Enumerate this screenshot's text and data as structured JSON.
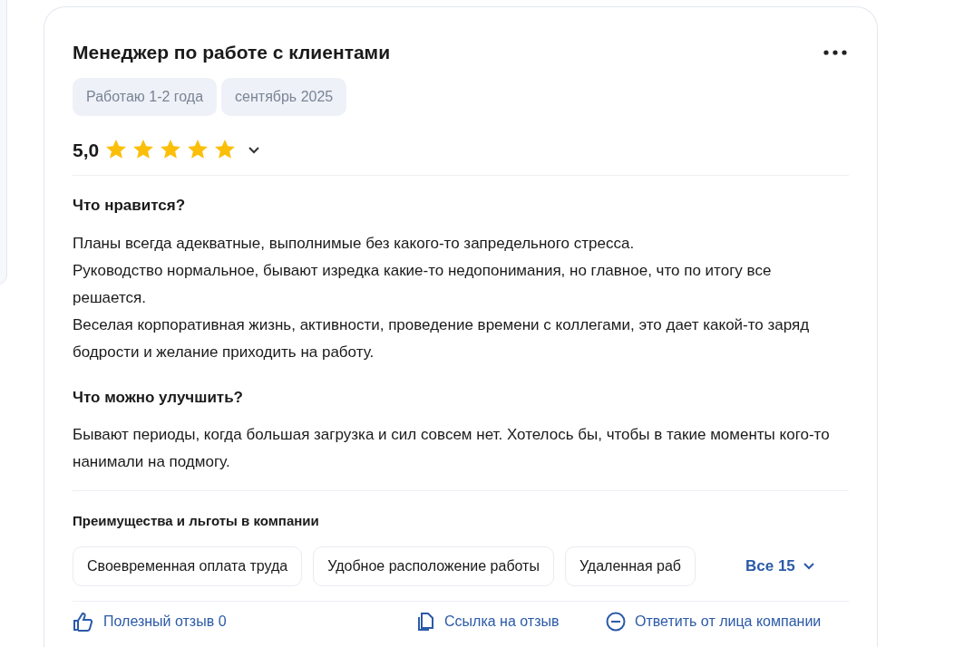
{
  "review": {
    "title": "Менеджер по работе с клиентами",
    "tags": [
      "Работаю 1-2 года",
      "сентябрь 2025"
    ],
    "rating": "5,0",
    "stars": 5,
    "sections": [
      {
        "heading": "Что нравится?",
        "paragraphs": [
          "Планы всегда адекватные, выполнимые без какого-то запредельного стресса.",
          "Руководство нормальное, бывают изредка какие-то недопонимания, но главное, что по итогу все решается.",
          "Веселая корпоративная жизнь, активности, проведение времени с коллегами, это дает какой-то заряд бодрости и желание приходить на работу."
        ]
      },
      {
        "heading": "Что можно улучшить?",
        "paragraphs": [
          "Бывают периоды, когда большая загрузка и сил совсем нет. Хотелось бы, чтобы в такие моменты кого-то нанимали на подмогу."
        ]
      }
    ],
    "benefits": {
      "heading": "Преимущества и льготы в компании",
      "items": [
        "Своевременная оплата труда",
        "Удобное расположение работы",
        "Удаленная раб"
      ],
      "more": "Все 15"
    },
    "actions": [
      {
        "kind": "like",
        "label": "Полезный отзыв 0"
      },
      {
        "kind": "link",
        "label": "Ссылка на отзыв"
      },
      {
        "kind": "reply",
        "label": "Ответить от лица компании"
      }
    ]
  }
}
